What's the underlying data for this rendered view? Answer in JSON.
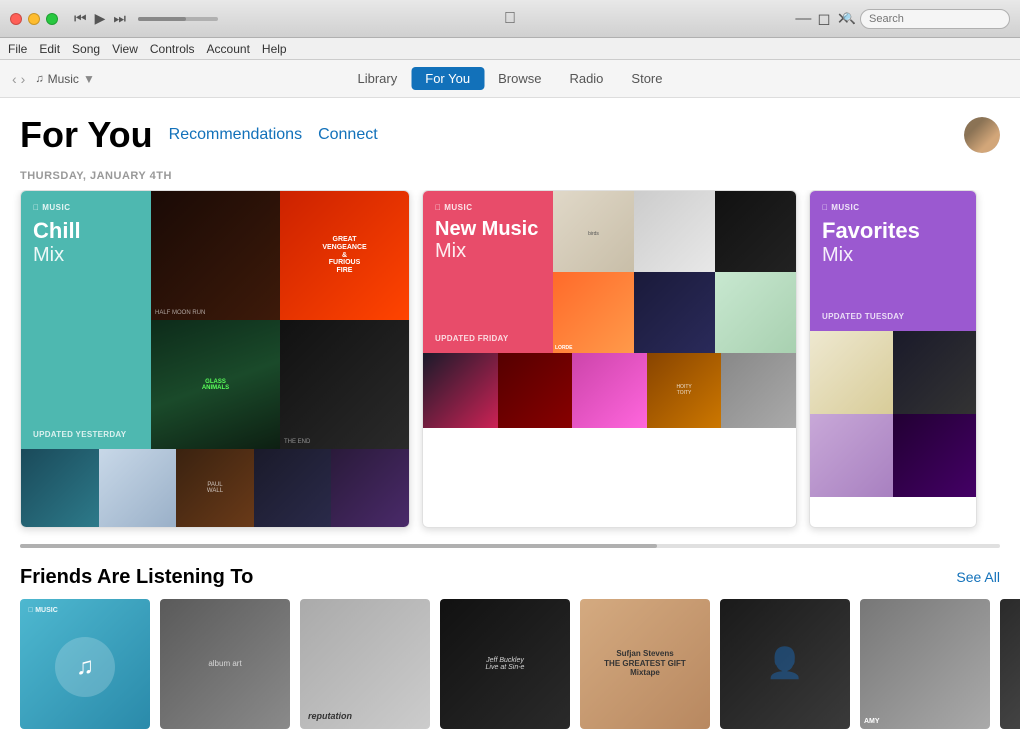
{
  "titlebar": {
    "search_placeholder": "Search"
  },
  "menubar": {
    "items": [
      "File",
      "Edit",
      "Song",
      "View",
      "Controls",
      "Account",
      "Help"
    ]
  },
  "navbar": {
    "location": "Music",
    "tabs": [
      {
        "label": "Library",
        "active": false
      },
      {
        "label": "For You",
        "active": true
      },
      {
        "label": "Browse",
        "active": false
      },
      {
        "label": "Radio",
        "active": false
      },
      {
        "label": "Store",
        "active": false
      }
    ]
  },
  "page": {
    "title": "For You",
    "links": [
      "Recommendations",
      "Connect"
    ],
    "date_label": "THURSDAY, JANUARY 4TH"
  },
  "mixes": [
    {
      "name": "Chill",
      "subtitle": "Mix",
      "color_class": "chill",
      "updated": "UPDATED YESTERDAY"
    },
    {
      "name": "New Music",
      "subtitle": "Mix",
      "color_class": "newmusic",
      "updated": "UPDATED FRIDAY"
    },
    {
      "name": "Favorites",
      "subtitle": "Mix",
      "color_class": "favorites",
      "updated": "UPDATED TUESDAY"
    }
  ],
  "friends_section": {
    "title": "Friends Are Listening To",
    "see_all": "See All"
  }
}
